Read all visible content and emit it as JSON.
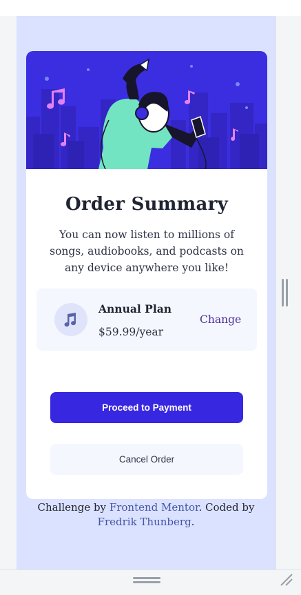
{
  "order_card": {
    "title": "Order Summary",
    "description": "You can now listen to millions of songs, audiobooks, and podcasts on any device anywhere you like!",
    "plan": {
      "icon": "music-note-icon",
      "name": "Annual Plan",
      "price": "$59.99/year",
      "change_label": "Change"
    },
    "proceed_label": "Proceed to Payment",
    "cancel_label": "Cancel Order"
  },
  "attribution": {
    "prefix": "Challenge by ",
    "frontend_mentor": "Frontend Mentor",
    "middle": ". Coded by ",
    "author": "Fredrik Thunberg",
    "suffix": "."
  },
  "colors": {
    "page_background": "#dbe2ff",
    "hero_background": "#3a2ee0",
    "primary_button": "#3827e0",
    "link": "#4453a8",
    "change_link": "#4a2f9a"
  }
}
